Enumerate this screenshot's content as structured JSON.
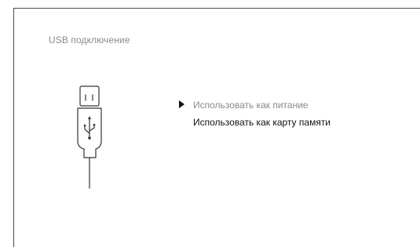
{
  "screen": {
    "title": "USB подключение"
  },
  "menu": {
    "items": [
      {
        "label": "Использовать как питание",
        "selected": true
      },
      {
        "label": "Использовать как карту памяти",
        "selected": false
      }
    ]
  },
  "icons": {
    "main": "usb-plug-icon",
    "cursor": "triangle-right-icon"
  },
  "colors": {
    "selected_text": "#8a8a8a",
    "normal_text": "#111111",
    "frame": "#4a4a4a",
    "icon_stroke": "#333333"
  }
}
